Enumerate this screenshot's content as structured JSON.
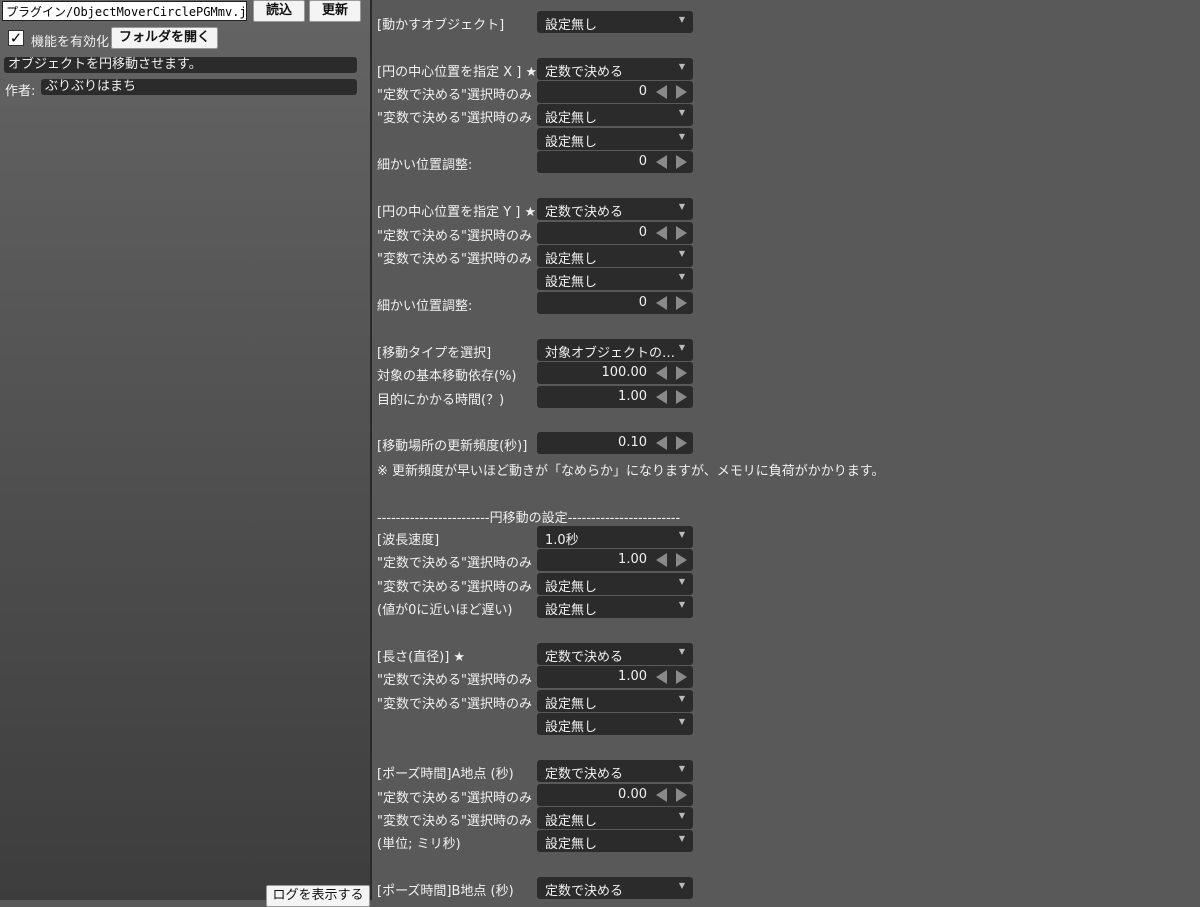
{
  "sidebar": {
    "plugin_path": "プラグイン/ObjectMoverCirclePGMmv.js",
    "load_button": "読込",
    "update_button": "更新",
    "checkbox_checked": true,
    "checkbox_mark": "✓",
    "enable_label": "機能を有効化",
    "open_folder_button": "フォルダを開く",
    "description": "オブジェクトを円移動させます。",
    "author_label": "作者:",
    "author_value": "ぶりぶりはまち",
    "log_button": "ログを表示する"
  },
  "params": {
    "target_object": {
      "label": "[動かすオブジェクト]",
      "value": "設定無し"
    },
    "center_x": {
      "label": "[円の中心位置を指定 X ] ★",
      "mode": "定数で決める",
      "const_label": "\"定数で決める\"選択時のみ",
      "const_value": "0",
      "var_label": "\"変数で決める\"選択時のみ",
      "var_value": "設定無し",
      "var_value2": "設定無し",
      "fine_label": "細かい位置調整:",
      "fine_value": "0"
    },
    "center_y": {
      "label": "[円の中心位置を指定 Y ] ★",
      "mode": "定数で決める",
      "const_label": "\"定数で決める\"選択時のみ",
      "const_value": "0",
      "var_label": "\"変数で決める\"選択時のみ",
      "var_value": "設定無し",
      "var_value2": "設定無し",
      "fine_label": "細かい位置調整:",
      "fine_value": "0"
    },
    "move_type": {
      "label": "[移動タイプを選択]",
      "value": "対象オブジェクトの…",
      "base_label": "対象の基本移動依存(%)",
      "base_value": "100.00",
      "time_label": "目的にかかる時間(？)",
      "time_value": "1.00"
    },
    "update_freq": {
      "label": "[移動場所の更新頻度(秒)]",
      "value": "0.10",
      "note": "※ 更新頻度が早いほど動きが「なめらか」になりますが、メモリに負荷がかかります。"
    },
    "circle_section_title": "------------------------円移動の設定------------------------",
    "wave_speed": {
      "label": "[波長速度]",
      "value": "1.0秒",
      "const_label": "\"定数で決める\"選択時のみ",
      "const_value": "1.00",
      "var_label": "\"変数で決める\"選択時のみ",
      "var_value": "設定無し",
      "hint_label": "(値が0に近いほど遅い)",
      "var_value2": "設定無し"
    },
    "length": {
      "label": "[長さ(直径)] ★",
      "mode": "定数で決める",
      "const_label": "\"定数で決める\"選択時のみ",
      "const_value": "1.00",
      "var_label": "\"変数で決める\"選択時のみ",
      "var_value": "設定無し",
      "var_value2": "設定無し"
    },
    "pause_a": {
      "label": "[ポーズ時間]A地点 (秒)",
      "mode": "定数で決める",
      "const_label": "\"定数で決める\"選択時のみ",
      "const_value": "0.00",
      "var_label": "\"変数で決める\"選択時のみ",
      "var_value": "設定無し",
      "unit_label": "(単位; ミリ秒)",
      "var_value2": "設定無し"
    },
    "pause_b": {
      "label": "[ポーズ時間]B地点 (秒)",
      "mode": "定数で決める"
    }
  }
}
